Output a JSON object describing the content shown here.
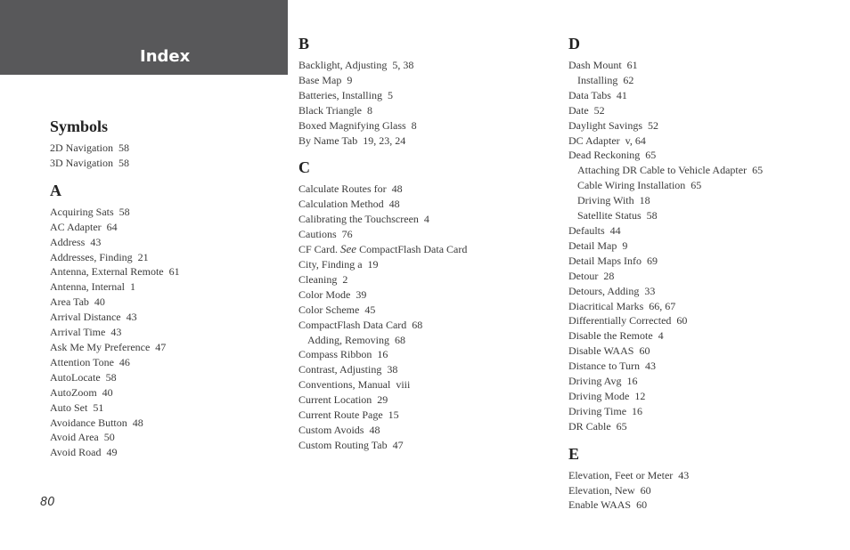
{
  "header": {
    "title": "Index",
    "band_color": "#58585a"
  },
  "page_number": "80",
  "columns": [
    {
      "sections": [
        {
          "heading": "Symbols",
          "entries": [
            {
              "text": "2D Navigation  58",
              "sub": false
            },
            {
              "text": "3D Navigation  58",
              "sub": false
            }
          ]
        },
        {
          "heading": "A",
          "entries": [
            {
              "text": "Acquiring Sats  58",
              "sub": false
            },
            {
              "text": "AC Adapter  64",
              "sub": false
            },
            {
              "text": "Address  43",
              "sub": false
            },
            {
              "text": "Addresses, Finding  21",
              "sub": false
            },
            {
              "text": "Antenna, External Remote  61",
              "sub": false
            },
            {
              "text": "Antenna, Internal  1",
              "sub": false
            },
            {
              "text": "Area Tab  40",
              "sub": false
            },
            {
              "text": "Arrival Distance  43",
              "sub": false
            },
            {
              "text": "Arrival Time  43",
              "sub": false
            },
            {
              "text": "Ask Me My Preference  47",
              "sub": false
            },
            {
              "text": "Attention Tone  46",
              "sub": false
            },
            {
              "text": "AutoLocate  58",
              "sub": false
            },
            {
              "text": "AutoZoom  40",
              "sub": false
            },
            {
              "text": "Auto Set  51",
              "sub": false
            },
            {
              "text": "Avoidance Button  48",
              "sub": false
            },
            {
              "text": "Avoid Area  50",
              "sub": false
            },
            {
              "text": "Avoid Road  49",
              "sub": false
            }
          ]
        }
      ]
    },
    {
      "sections": [
        {
          "heading": "B",
          "entries": [
            {
              "text": "Backlight, Adjusting  5, 38",
              "sub": false
            },
            {
              "text": "Base Map  9",
              "sub": false
            },
            {
              "text": "Batteries, Installing  5",
              "sub": false
            },
            {
              "text": "Black Triangle  8",
              "sub": false
            },
            {
              "text": "Boxed Magnifying Glass  8",
              "sub": false
            },
            {
              "text": "By Name Tab  19, 23, 24",
              "sub": false
            }
          ]
        },
        {
          "heading": "C",
          "entries": [
            {
              "text": "Calculate Routes for  48",
              "sub": false
            },
            {
              "text": "Calculation Method  48",
              "sub": false
            },
            {
              "text": "Calibrating the Touchscreen  4",
              "sub": false
            },
            {
              "text": "Cautions  76",
              "sub": false
            },
            {
              "text": "CF Card. ",
              "see": "See",
              "after": " CompactFlash Data Card",
              "sub": false
            },
            {
              "text": "City, Finding a  19",
              "sub": false
            },
            {
              "text": "Cleaning  2",
              "sub": false
            },
            {
              "text": "Color Mode  39",
              "sub": false
            },
            {
              "text": "Color Scheme  45",
              "sub": false
            },
            {
              "text": "CompactFlash Data Card  68",
              "sub": false
            },
            {
              "text": "Adding, Removing  68",
              "sub": true
            },
            {
              "text": "Compass Ribbon  16",
              "sub": false
            },
            {
              "text": "Contrast, Adjusting  38",
              "sub": false
            },
            {
              "text": "Conventions, Manual  viii",
              "sub": false
            },
            {
              "text": "Current Location  29",
              "sub": false
            },
            {
              "text": "Current Route Page  15",
              "sub": false
            },
            {
              "text": "Custom Avoids  48",
              "sub": false
            },
            {
              "text": "Custom Routing Tab  47",
              "sub": false
            }
          ]
        }
      ]
    },
    {
      "sections": [
        {
          "heading": "D",
          "entries": [
            {
              "text": "Dash Mount  61",
              "sub": false
            },
            {
              "text": "Installing  62",
              "sub": true
            },
            {
              "text": "Data Tabs  41",
              "sub": false
            },
            {
              "text": "Date  52",
              "sub": false
            },
            {
              "text": "Daylight Savings  52",
              "sub": false
            },
            {
              "text": "DC Adapter  v, 64",
              "sub": false
            },
            {
              "text": "Dead Reckoning  65",
              "sub": false
            },
            {
              "text": "Attaching DR Cable to Vehicle Adapter  65",
              "sub": true
            },
            {
              "text": "Cable Wiring Installation  65",
              "sub": true
            },
            {
              "text": "Driving With  18",
              "sub": true
            },
            {
              "text": "Satellite Status  58",
              "sub": true
            },
            {
              "text": "Defaults  44",
              "sub": false
            },
            {
              "text": "Detail Map  9",
              "sub": false
            },
            {
              "text": "Detail Maps Info  69",
              "sub": false
            },
            {
              "text": "Detour  28",
              "sub": false
            },
            {
              "text": "Detours, Adding  33",
              "sub": false
            },
            {
              "text": "Diacritical Marks  66, 67",
              "sub": false
            },
            {
              "text": "Differentially Corrected  60",
              "sub": false
            },
            {
              "text": "Disable the Remote  4",
              "sub": false
            },
            {
              "text": "Disable WAAS  60",
              "sub": false
            },
            {
              "text": "Distance to Turn  43",
              "sub": false
            },
            {
              "text": "Driving Avg  16",
              "sub": false
            },
            {
              "text": "Driving Mode  12",
              "sub": false
            },
            {
              "text": "Driving Time  16",
              "sub": false
            },
            {
              "text": "DR Cable  65",
              "sub": false
            }
          ]
        },
        {
          "heading": "E",
          "entries": [
            {
              "text": "Elevation, Feet or Meter  43",
              "sub": false
            },
            {
              "text": "Elevation, New  60",
              "sub": false
            },
            {
              "text": "Enable WAAS  60",
              "sub": false
            }
          ]
        }
      ]
    }
  ]
}
